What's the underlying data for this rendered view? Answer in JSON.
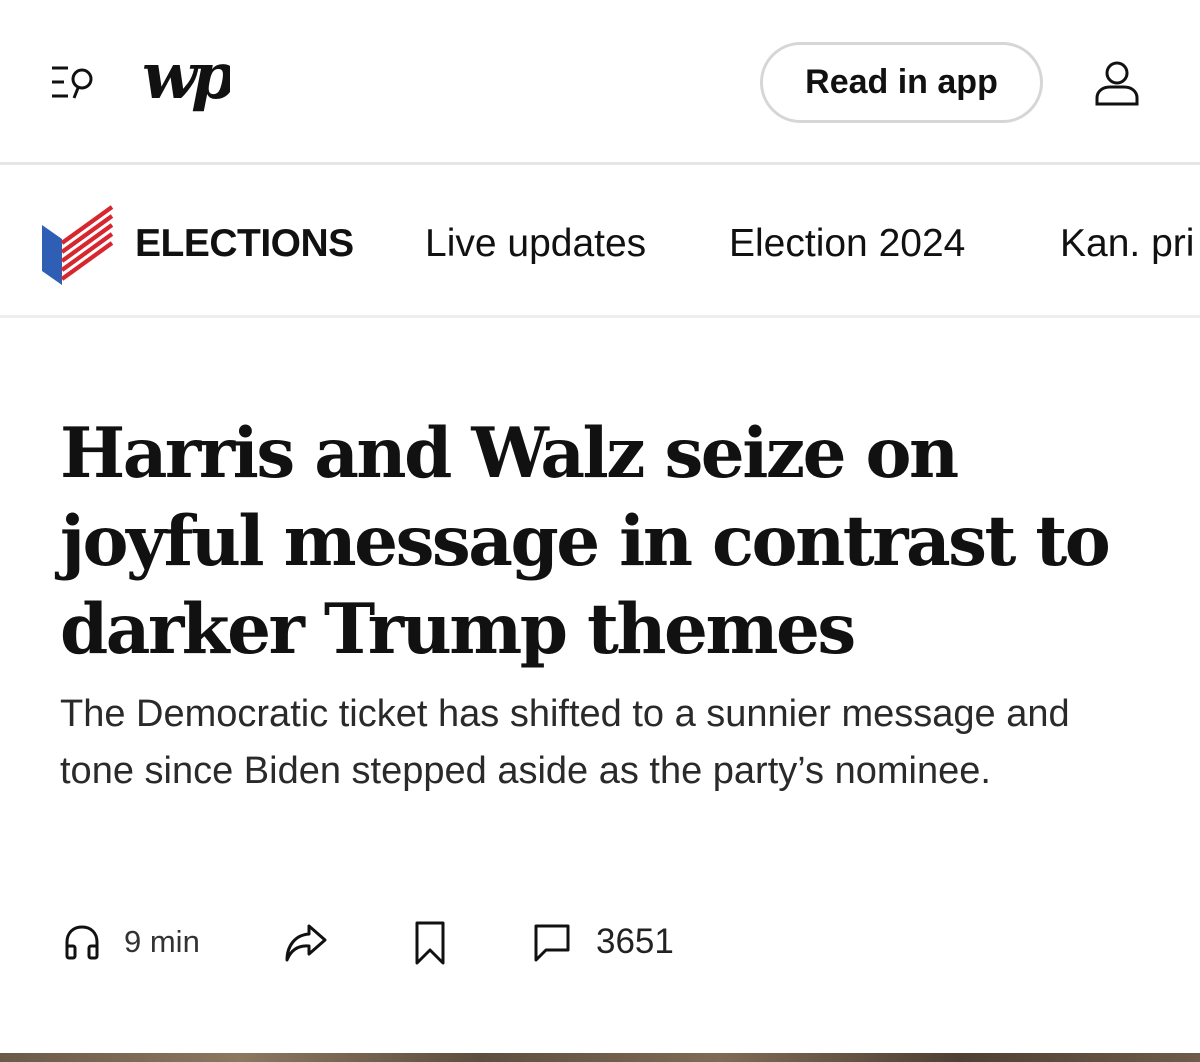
{
  "header": {
    "logo_text": "wp",
    "read_in_app_label": "Read in app",
    "icons": [
      "menu-search-icon",
      "user-icon"
    ]
  },
  "section_nav": {
    "section_label": "ELECTIONS",
    "links": [
      "Live updates",
      "Election 2024",
      "Kan. pri"
    ]
  },
  "article": {
    "headline": "Harris and Walz seize on joyful message in contrast to darker Trump themes",
    "dek": "The Democratic ticket has shifted to a sunnier message and tone since Biden stepped aside as the party’s nominee."
  },
  "actions": {
    "listen_time": "9 min",
    "comment_count": "3651",
    "icons": [
      "headphones-icon",
      "share-icon",
      "bookmark-icon",
      "comment-icon"
    ]
  },
  "colors": {
    "flag_blue": "#2f5fb5",
    "flag_red": "#d8262f",
    "divider": "#e6e6e6",
    "pill_border": "#d6d6d6"
  }
}
